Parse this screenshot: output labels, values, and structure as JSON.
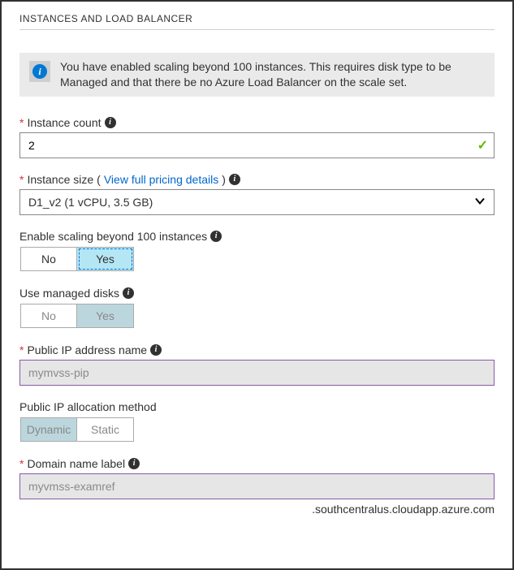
{
  "section_title": "INSTANCES AND LOAD BALANCER",
  "info_banner": {
    "icon_glyph": "i",
    "text": "You have enabled scaling beyond 100 instances. This requires disk type to be Managed and that there be no Azure Load Balancer on the scale set."
  },
  "fields": {
    "instance_count": {
      "required": true,
      "label": "Instance count",
      "value": "2",
      "valid": true
    },
    "instance_size": {
      "required": true,
      "label": "Instance size",
      "link_text": "View full pricing details",
      "value": "D1_v2 (1 vCPU, 3.5 GB)"
    },
    "scale_beyond": {
      "label": "Enable scaling beyond 100 instances",
      "options": [
        "No",
        "Yes"
      ],
      "selected": "Yes",
      "disabled": false
    },
    "managed_disks": {
      "label": "Use managed disks",
      "options": [
        "No",
        "Yes"
      ],
      "selected": "Yes",
      "disabled": true
    },
    "pip_name": {
      "required": true,
      "label": "Public IP address name",
      "value": "mymvss-pip",
      "disabled": true
    },
    "pip_alloc": {
      "label": "Public IP allocation method",
      "options": [
        "Dynamic",
        "Static"
      ],
      "selected": "Dynamic",
      "disabled": true
    },
    "dns_label": {
      "required": true,
      "label": "Domain name label",
      "value": "myvmss-examref",
      "disabled": true,
      "suffix": ".southcentralus.cloudapp.azure.com"
    }
  },
  "glyphs": {
    "required": "*",
    "help": "i",
    "check": "✓",
    "chevron": "⌄"
  }
}
